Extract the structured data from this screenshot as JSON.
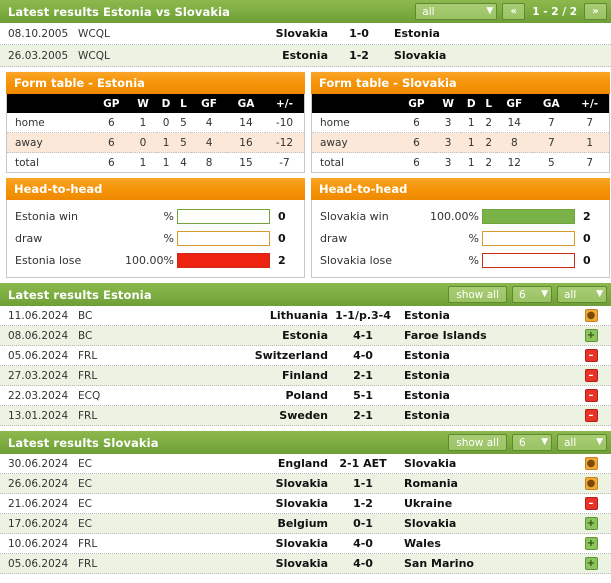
{
  "vs_panel": {
    "title": "Latest results Estonia vs Slovakia",
    "filter_select": "all",
    "prev_label": "«",
    "next_label": "»",
    "pager_text": "1 - 2 / 2",
    "rows": [
      {
        "date": "08.10.2005",
        "competition": "WCQL",
        "home": "Slovakia",
        "score": "1-0",
        "away": "Estonia"
      },
      {
        "date": "26.03.2005",
        "competition": "WCQL",
        "home": "Estonia",
        "score": "1-2",
        "away": "Slovakia"
      }
    ]
  },
  "form_tables": [
    {
      "title": "Form table - Estonia",
      "columns": [
        "",
        "GP",
        "W",
        "D",
        "L",
        "GF",
        "GA",
        "+/-"
      ],
      "rows": [
        {
          "label": "home",
          "gp": "6",
          "w": "1",
          "d": "0",
          "l": "5",
          "gf": "4",
          "ga": "14",
          "diff": "-10"
        },
        {
          "label": "away",
          "gp": "6",
          "w": "0",
          "d": "1",
          "l": "5",
          "gf": "4",
          "ga": "16",
          "diff": "-12"
        },
        {
          "label": "total",
          "gp": "6",
          "w": "1",
          "d": "1",
          "l": "4",
          "gf": "8",
          "ga": "15",
          "diff": "-7"
        }
      ]
    },
    {
      "title": "Form table - Slovakia",
      "columns": [
        "",
        "GP",
        "W",
        "D",
        "L",
        "GF",
        "GA",
        "+/-"
      ],
      "rows": [
        {
          "label": "home",
          "gp": "6",
          "w": "3",
          "d": "1",
          "l": "2",
          "gf": "14",
          "ga": "7",
          "diff": "7"
        },
        {
          "label": "away",
          "gp": "6",
          "w": "3",
          "d": "1",
          "l": "2",
          "gf": "8",
          "ga": "7",
          "diff": "1"
        },
        {
          "label": "total",
          "gp": "6",
          "w": "3",
          "d": "1",
          "l": "2",
          "gf": "12",
          "ga": "5",
          "diff": "7"
        }
      ]
    }
  ],
  "head_to_head": [
    {
      "title": "Head-to-head",
      "rows": [
        {
          "label": "Estonia win",
          "percent": "%",
          "fill": 0,
          "count": "0",
          "kind": "win"
        },
        {
          "label": "draw",
          "percent": "%",
          "fill": 0,
          "count": "0",
          "kind": "draw"
        },
        {
          "label": "Estonia lose",
          "percent": "100.00%",
          "fill": 100,
          "count": "2",
          "kind": "lose"
        }
      ]
    },
    {
      "title": "Head-to-head",
      "rows": [
        {
          "label": "Slovakia win",
          "percent": "100.00%",
          "fill": 100,
          "count": "2",
          "kind": "win"
        },
        {
          "label": "draw",
          "percent": "%",
          "fill": 0,
          "count": "0",
          "kind": "draw"
        },
        {
          "label": "Slovakia lose",
          "percent": "%",
          "fill": 0,
          "count": "0",
          "kind": "lose"
        }
      ]
    }
  ],
  "latest_results": [
    {
      "title": "Latest results Estonia",
      "show_all_label": "show all",
      "count_select": "6",
      "filter_select": "all",
      "rows": [
        {
          "date": "11.06.2024",
          "competition": "BC",
          "home": "Lithuania",
          "score": "1-1/p.3-4",
          "away": "Estonia",
          "result": "draw",
          "icon": "●"
        },
        {
          "date": "08.06.2024",
          "competition": "BC",
          "home": "Estonia",
          "score": "4-1",
          "away": "Faroe Islands",
          "result": "win",
          "icon": "+"
        },
        {
          "date": "05.06.2024",
          "competition": "FRL",
          "home": "Switzerland",
          "score": "4-0",
          "away": "Estonia",
          "result": "lose",
          "icon": "–"
        },
        {
          "date": "27.03.2024",
          "competition": "FRL",
          "home": "Finland",
          "score": "2-1",
          "away": "Estonia",
          "result": "lose",
          "icon": "–"
        },
        {
          "date": "22.03.2024",
          "competition": "ECQ",
          "home": "Poland",
          "score": "5-1",
          "away": "Estonia",
          "result": "lose",
          "icon": "–"
        },
        {
          "date": "13.01.2024",
          "competition": "FRL",
          "home": "Sweden",
          "score": "2-1",
          "away": "Estonia",
          "result": "lose",
          "icon": "–"
        }
      ]
    },
    {
      "title": "Latest results Slovakia",
      "show_all_label": "show all",
      "count_select": "6",
      "filter_select": "all",
      "rows": [
        {
          "date": "30.06.2024",
          "competition": "EC",
          "home": "England",
          "score": "2-1 AET",
          "away": "Slovakia",
          "result": "draw",
          "icon": "●"
        },
        {
          "date": "26.06.2024",
          "competition": "EC",
          "home": "Slovakia",
          "score": "1-1",
          "away": "Romania",
          "result": "draw",
          "icon": "●"
        },
        {
          "date": "21.06.2024",
          "competition": "EC",
          "home": "Slovakia",
          "score": "1-2",
          "away": "Ukraine",
          "result": "lose",
          "icon": "–"
        },
        {
          "date": "17.06.2024",
          "competition": "EC",
          "home": "Belgium",
          "score": "0-1",
          "away": "Slovakia",
          "result": "win",
          "icon": "+"
        },
        {
          "date": "10.06.2024",
          "competition": "FRL",
          "home": "Slovakia",
          "score": "4-0",
          "away": "Wales",
          "result": "win",
          "icon": "+"
        },
        {
          "date": "05.06.2024",
          "competition": "FRL",
          "home": "Slovakia",
          "score": "4-0",
          "away": "San Marino",
          "result": "win",
          "icon": "+"
        }
      ]
    }
  ]
}
